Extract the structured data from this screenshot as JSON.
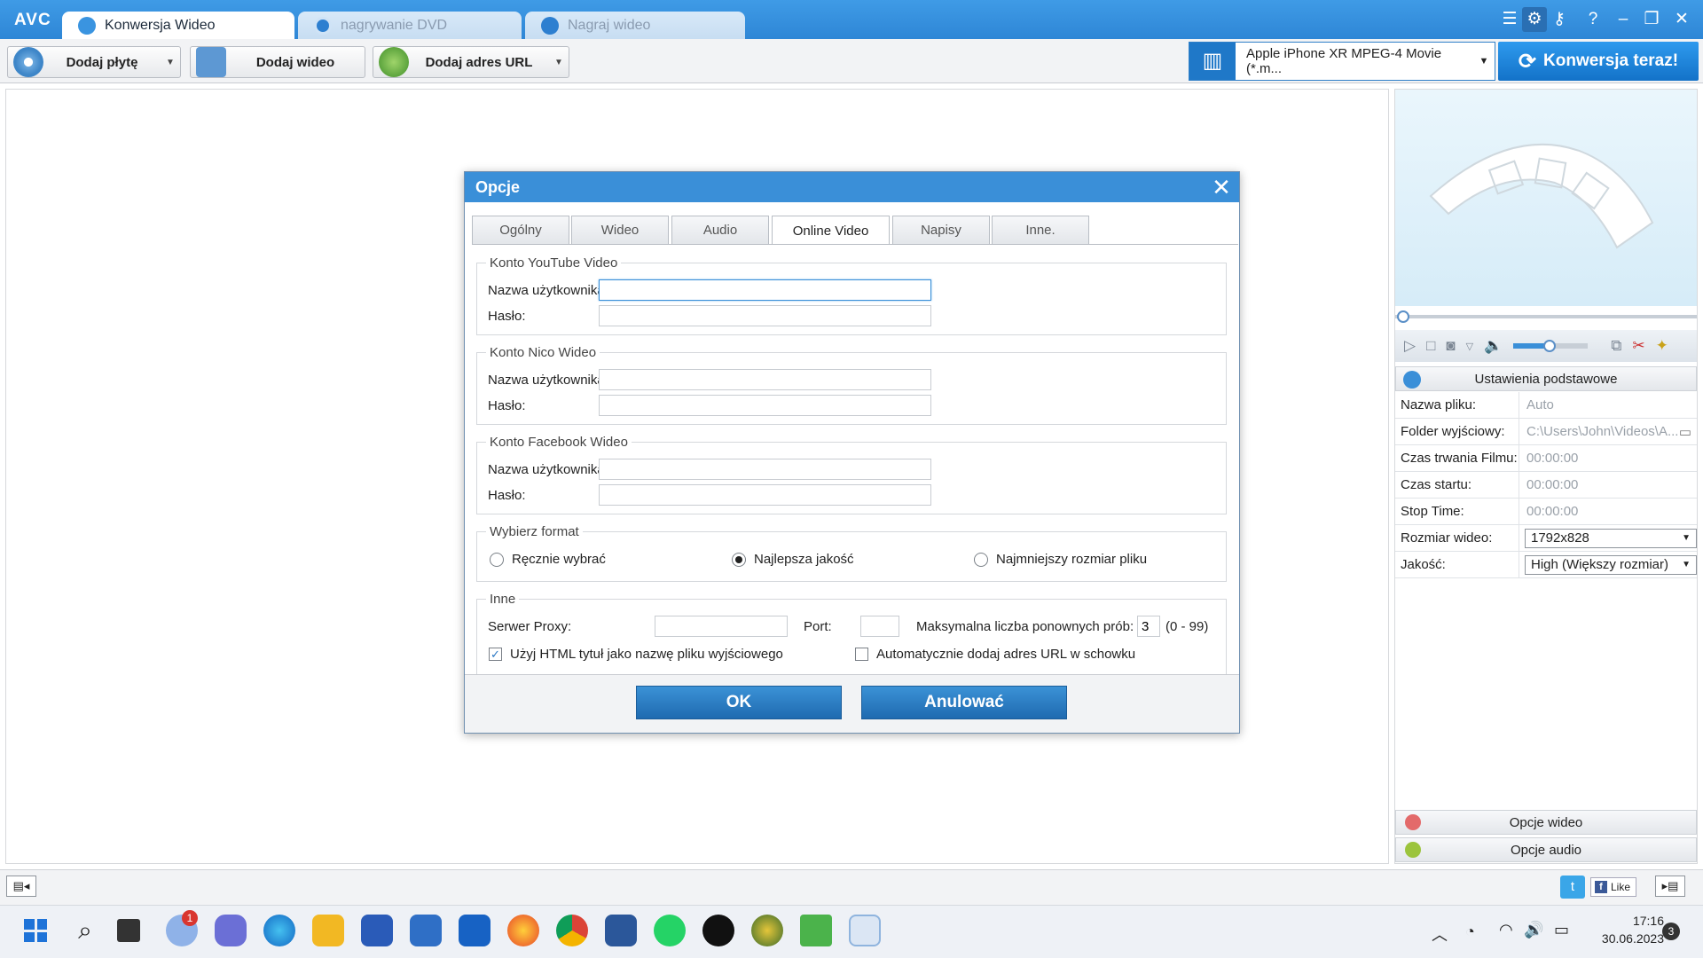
{
  "app": {
    "logo": "AVC",
    "tabs": [
      {
        "label": "Konwersja Wideo",
        "active": true
      },
      {
        "label": "nagrywanie DVD",
        "active": false
      },
      {
        "label": "Nagraj wideo",
        "active": false
      }
    ],
    "window_controls": [
      "list-icon",
      "gear-icon",
      "key-icon",
      "help-icon",
      "minimize-icon",
      "restore-icon",
      "close-icon"
    ]
  },
  "toolbar": {
    "add_disc": "Dodaj płytę",
    "add_video": "Dodaj wideo",
    "add_url": "Dodaj adres URL",
    "profile": "Apple iPhone XR MPEG-4 Movie (*.m...",
    "convert_now": "Konwersja teraz!"
  },
  "right_panel": {
    "settings_title": "Ustawienia podstawowe",
    "rows": [
      {
        "key": "Nazwa pliku:",
        "value": "Auto"
      },
      {
        "key": "Folder wyjściowy:",
        "value": "C:\\Users\\John\\Videos\\A..."
      },
      {
        "key": "Czas trwania Filmu:",
        "value": "00:00:00"
      },
      {
        "key": "Czas startu:",
        "value": "00:00:00"
      },
      {
        "key": "Stop Time:",
        "value": "00:00:00"
      }
    ],
    "video_size_label": "Rozmiar wideo:",
    "video_size_value": "1792x828",
    "quality_label": "Jakość:",
    "quality_value": "High (Większy rozmiar)",
    "video_options": "Opcje wideo",
    "audio_options": "Opcje audio"
  },
  "statusbar": {
    "like": "Like"
  },
  "dialog": {
    "title": "Opcje",
    "tabs": [
      "Ogólny",
      "Wideo",
      "Audio",
      "Online Video",
      "Napisy",
      "Inne."
    ],
    "active_tab": "Online Video",
    "youtube": {
      "legend": "Konto YouTube Video",
      "user_label": "Nazwa użytkownika:",
      "user_value": "",
      "pass_label": "Hasło:",
      "pass_value": ""
    },
    "nico": {
      "legend": "Konto Nico Wideo",
      "user_label": "Nazwa użytkownika:",
      "pass_label": "Hasło:"
    },
    "facebook": {
      "legend": "Konto Facebook Wideo",
      "user_label": "Nazwa użytkownika:",
      "pass_label": "Hasło:"
    },
    "format": {
      "legend": "Wybierz format",
      "options": [
        "Ręcznie wybrać",
        "Najlepsza jakość",
        "Najmniejszy rozmiar pliku"
      ],
      "selected": "Najlepsza jakość"
    },
    "other": {
      "legend": "Inne",
      "proxy_label": "Serwer Proxy:",
      "proxy_value": "",
      "port_label": "Port:",
      "port_value": "",
      "retries_label": "Maksymalna liczba ponownych prób:",
      "retries_value": "3",
      "retries_range": "(0 - 99)",
      "use_html_title": "Użyj HTML tytuł jako nazwę pliku wyjściowego",
      "use_html_title_checked": true,
      "auto_add_url": "Automatycznie dodaj adres URL w schowku",
      "auto_add_url_checked": false
    },
    "ok": "OK",
    "cancel": "Anulować"
  },
  "taskbar": {
    "onedrive_badge": "1",
    "time": "17:16",
    "date": "30.06.2023",
    "notification_count": "3"
  }
}
